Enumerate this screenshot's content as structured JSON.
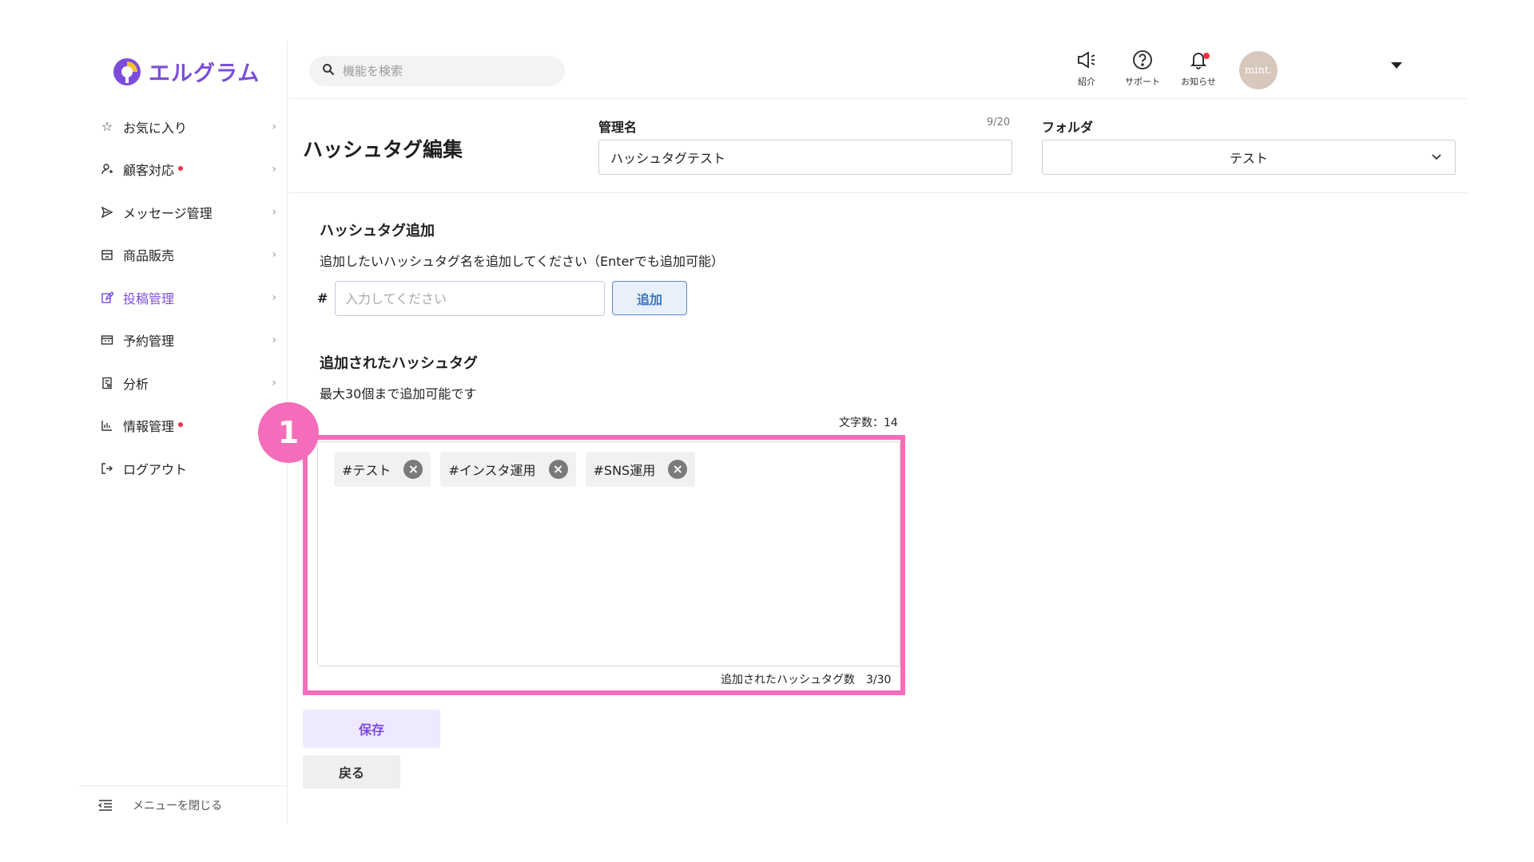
{
  "brand": {
    "name": "エルグラム",
    "color": "#7c4ddb"
  },
  "sidebar": {
    "items": [
      {
        "label": "お気に入り",
        "icon": "star-icon"
      },
      {
        "label": "顧客対応",
        "icon": "person-icon"
      },
      {
        "label": "メッセージ管理",
        "icon": "send-icon"
      },
      {
        "label": "商品販売",
        "icon": "shop-icon"
      },
      {
        "label": "投稿管理",
        "icon": "edit-icon"
      },
      {
        "label": "予約管理",
        "icon": "calendar-icon"
      },
      {
        "label": "分析",
        "icon": "report-icon"
      },
      {
        "label": "情報管理",
        "icon": "bar-chart-icon"
      },
      {
        "label": "ログアウト",
        "icon": "logout-icon"
      }
    ],
    "collapse_label": "メニューを閉じる"
  },
  "header": {
    "search_placeholder": "機能を検索",
    "intro_label": "紹介",
    "support_label": "サポート",
    "notice_label": "お知らせ",
    "avatar_text": "mint."
  },
  "title_bar": {
    "title": "ハッシュタグ編集",
    "name_label": "管理名",
    "name_counter": "9/20",
    "name_value": "ハッシュタグテスト",
    "folder_label": "フォルダ",
    "folder_value": "テスト"
  },
  "add_section": {
    "heading": "ハッシュタグ追加",
    "description": "追加したいハッシュタグ名を追加してください（Enterでも追加可能）",
    "hash_symbol": "#",
    "input_placeholder": "入力してください",
    "add_button": "追加"
  },
  "added_section": {
    "heading": "追加されたハッシュタグ",
    "description": "最大30個まで追加可能です",
    "char_count": "文字数：14",
    "tags": [
      "#テスト",
      "#インスタ運用",
      "#SNS運用"
    ],
    "tag_count": "追加されたハッシュタグ数　3/30",
    "badge": "1",
    "highlight_color": "#f56cba"
  },
  "actions": {
    "save": "保存",
    "back": "戻る"
  }
}
